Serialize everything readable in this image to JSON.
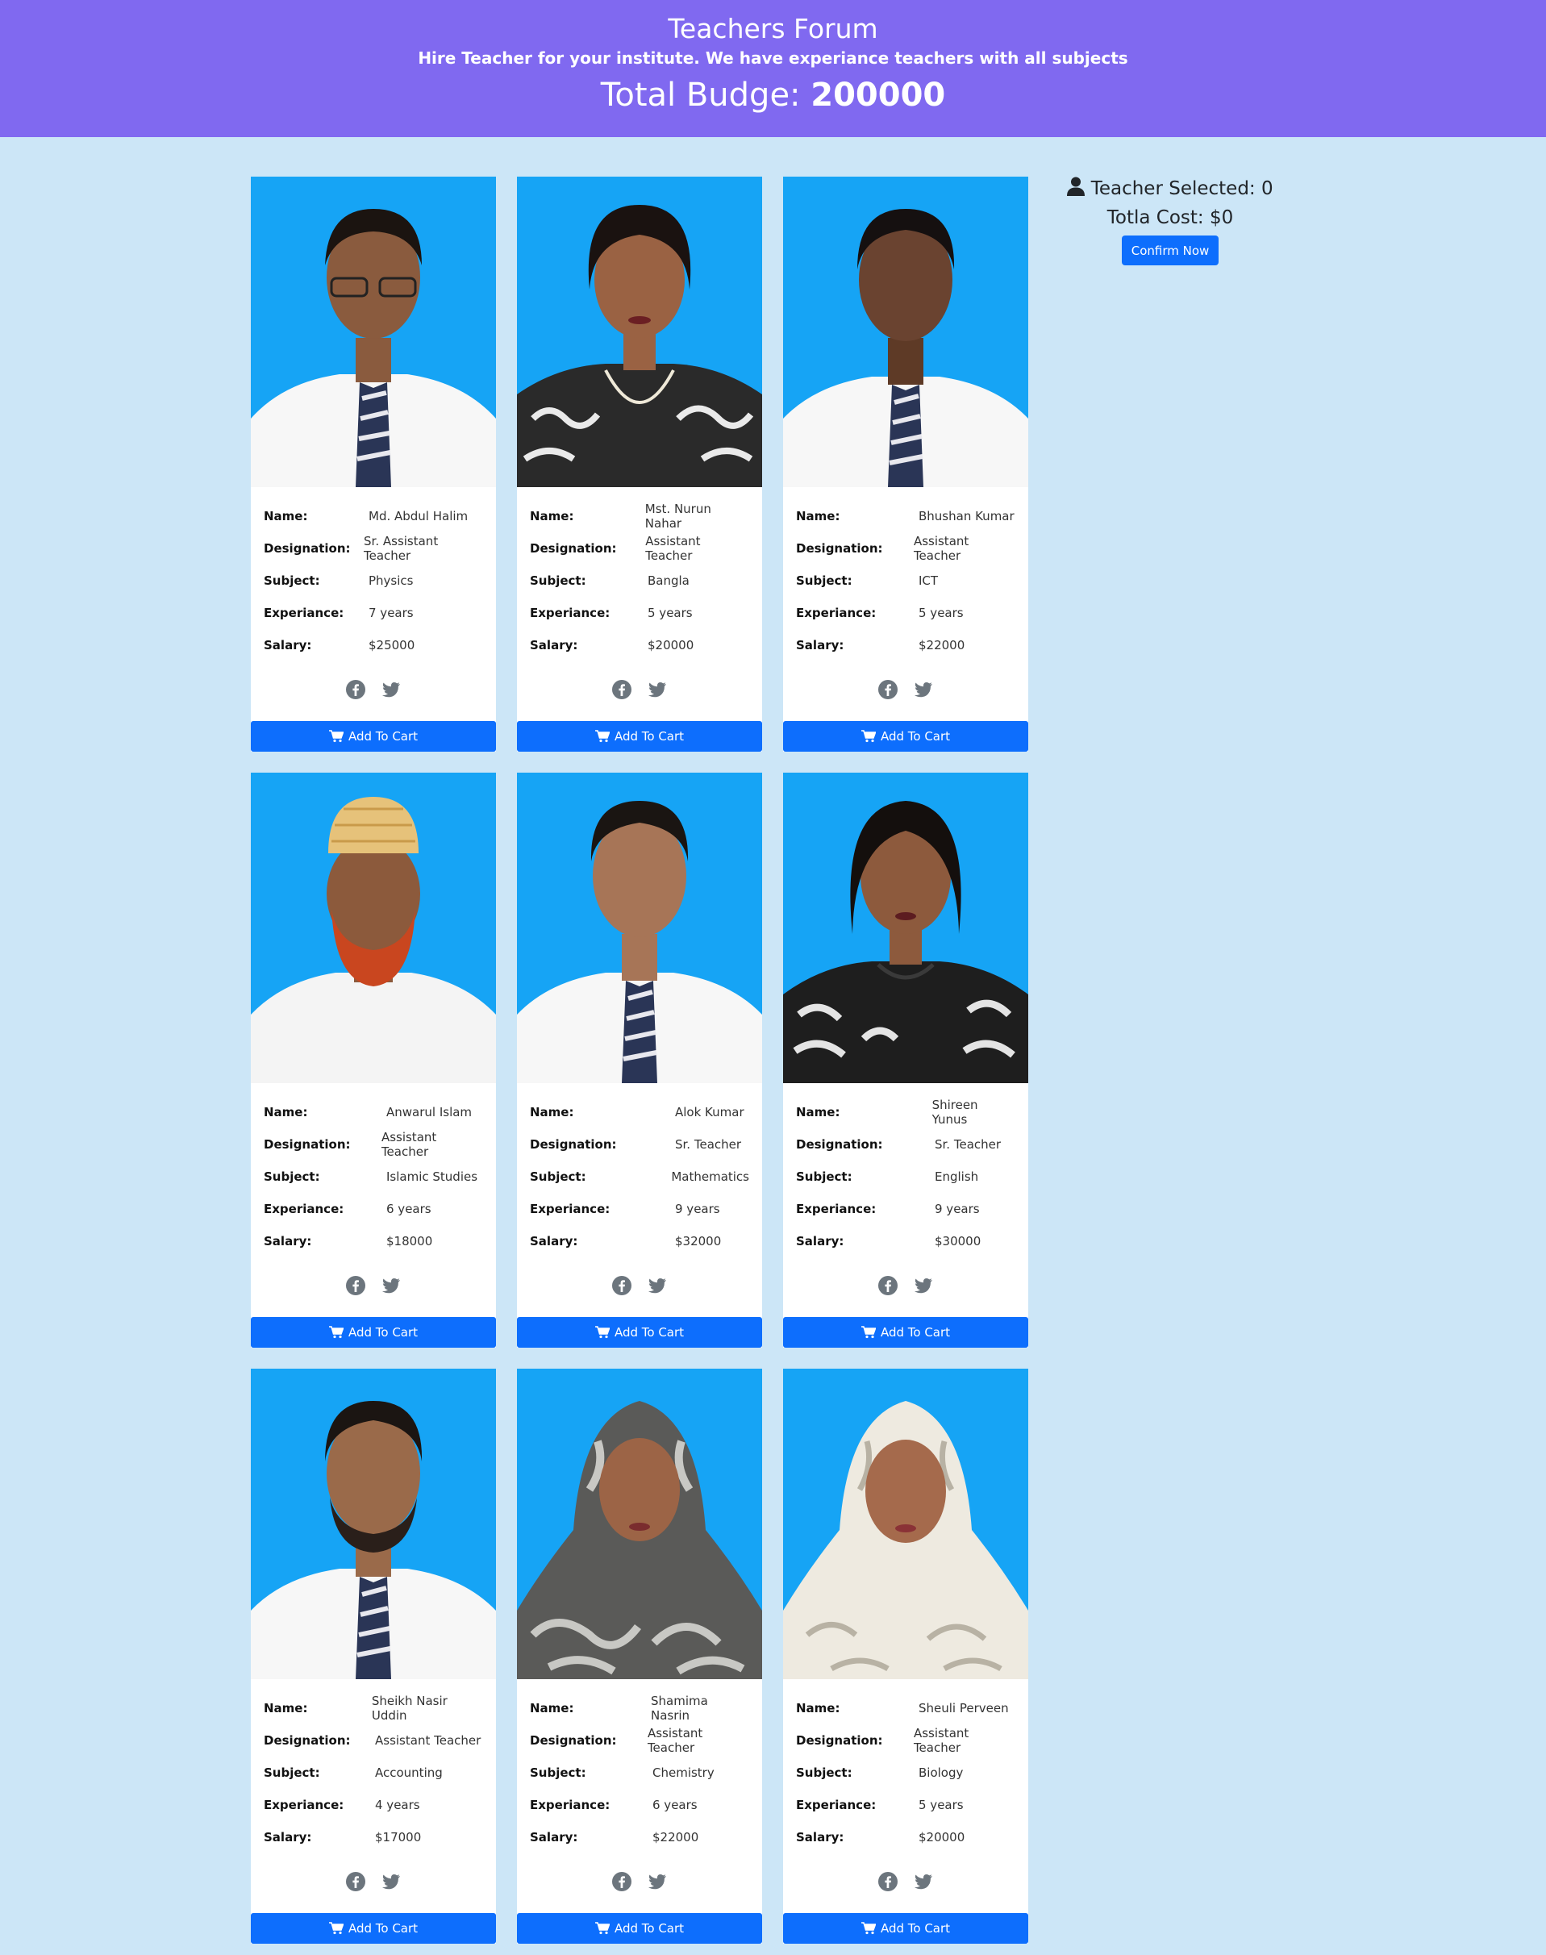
{
  "header": {
    "title": "Teachers Forum",
    "subtitle": "Hire Teacher for your institute. We have experiance teachers with all subjects",
    "budget_label": "Total Budge:",
    "budget_value": "200000"
  },
  "labels": {
    "name": "Name:",
    "designation": "Designation:",
    "subject": "Subject:",
    "experience": "Experiance:",
    "salary": "Salary:",
    "add_to_cart": "Add To Cart"
  },
  "colors": {
    "header_bg": "#8069f0",
    "page_bg": "#cce6f7",
    "photo_bg": "#16a4f5",
    "button": "#0d6efd"
  },
  "teachers": [
    {
      "name": "Md. Abdul Halim",
      "designation": "Sr. Assistant Teacher",
      "subject": "Physics",
      "experience": "7 years",
      "salary": "$25000"
    },
    {
      "name": "Mst. Nurun Nahar",
      "designation": "Assistant Teacher",
      "subject": "Bangla",
      "experience": "5 years",
      "salary": "$20000"
    },
    {
      "name": "Bhushan Kumar",
      "designation": "Assistant Teacher",
      "subject": "ICT",
      "experience": "5 years",
      "salary": "$22000"
    },
    {
      "name": "Anwarul Islam",
      "designation": "Assistant Teacher",
      "subject": "Islamic Studies",
      "experience": "6 years",
      "salary": "$18000"
    },
    {
      "name": "Alok Kumar",
      "designation": "Sr. Teacher",
      "subject": "Mathematics",
      "experience": "9 years",
      "salary": "$32000"
    },
    {
      "name": "Shireen Yunus",
      "designation": "Sr. Teacher",
      "subject": "English",
      "experience": "9 years",
      "salary": "$30000"
    },
    {
      "name": "Sheikh Nasir Uddin",
      "designation": "Assistant Teacher",
      "subject": "Accounting",
      "experience": "4 years",
      "salary": "$17000"
    },
    {
      "name": "Shamima Nasrin",
      "designation": "Assistant Teacher",
      "subject": "Chemistry",
      "experience": "6 years",
      "salary": "$22000"
    },
    {
      "name": "Sheuli Perveen",
      "designation": "Assistant Teacher",
      "subject": "Biology",
      "experience": "5 years",
      "salary": "$20000"
    }
  ],
  "sidebar": {
    "selected_label": "Teacher Selected:",
    "selected_count": "0",
    "cost_label": "Totla Cost:",
    "cost_value": "$0",
    "confirm_label": "Confirm Now",
    "user_icon": "user-icon"
  }
}
